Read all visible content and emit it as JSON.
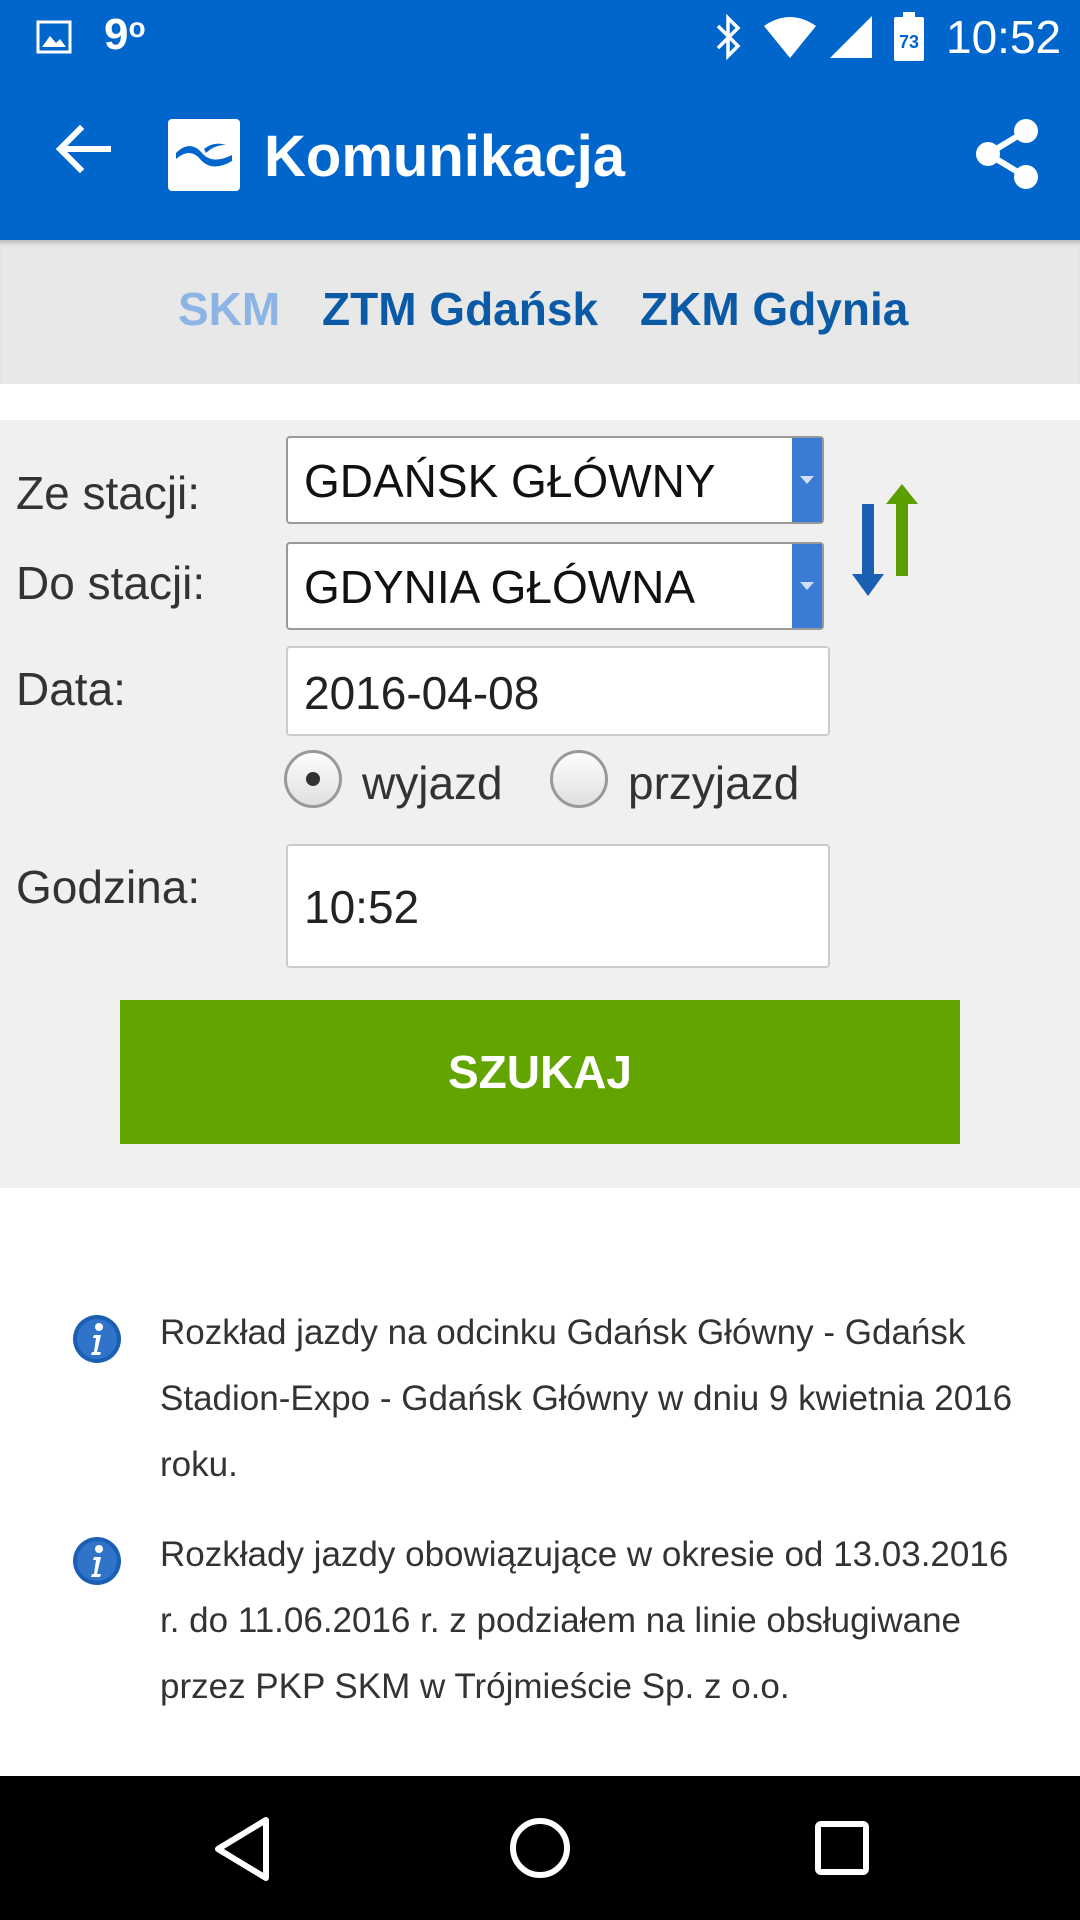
{
  "status_bar": {
    "temperature": "9",
    "temperature_unit": "o",
    "battery_level": "73",
    "time": "10:52"
  },
  "app_bar": {
    "title": "Komunikacja",
    "color": "#0066cc"
  },
  "tabs": [
    {
      "label": "SKM",
      "active": true
    },
    {
      "label": "ZTM Gdańsk",
      "active": false
    },
    {
      "label": "ZKM Gdynia",
      "active": false
    }
  ],
  "form": {
    "from_label": "Ze stacji:",
    "from_value": "GDAŃSK GŁÓWNY",
    "to_label": "Do stacji:",
    "to_value": "GDYNIA GŁÓWNA",
    "date_label": "Data:",
    "date_value": "2016-04-08",
    "radio_options": [
      {
        "label": "wyjazd",
        "selected": true
      },
      {
        "label": "przyjazd",
        "selected": false
      }
    ],
    "hour_label": "Godzina:",
    "hour_value": "10:52",
    "search_label": "SZUKAJ",
    "search_color": "#62a400"
  },
  "info": [
    {
      "icon": "info-icon",
      "text": "Rozkład jazdy na odcinku Gdańsk Główny - Gdańsk Stadion-Expo - Gdańsk Główny w dniu 9 kwietnia 2016 roku."
    },
    {
      "icon": "info-icon",
      "text": "Rozkłady jazdy obowiązujące w okresie od 13.03.2016 r. do 11.06.2016 r. z podziałem na linie obsługiwane przez PKP SKM w Trójmieście Sp. z o.o."
    }
  ]
}
